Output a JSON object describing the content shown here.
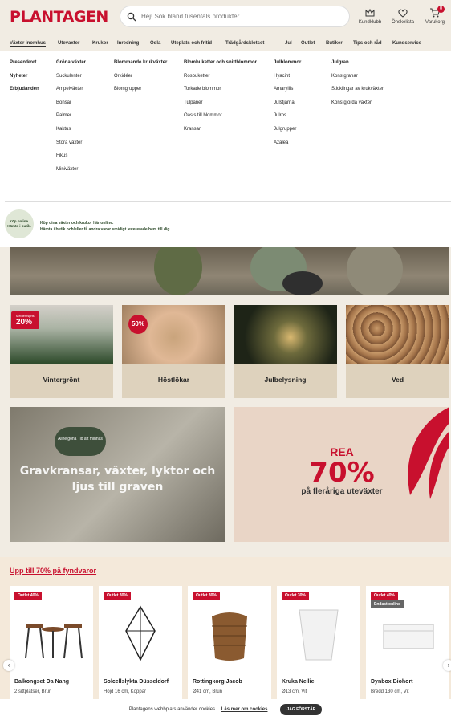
{
  "header": {
    "logo": "PLANTAGEN",
    "search_placeholder": "Hej! Sök bland tusentals produkter...",
    "icons": [
      {
        "name": "kundklubb",
        "label": "Kundklubb",
        "icon": "crown-icon"
      },
      {
        "name": "onskelista",
        "label": "Önskelista",
        "icon": "heart-icon"
      },
      {
        "name": "varukorg",
        "label": "Varukorg",
        "icon": "cart-icon",
        "badge": "0"
      }
    ]
  },
  "nav": [
    "Växter inomhus",
    "Utevaxter",
    "Krukor",
    "Inredning",
    "Odla",
    "Uteplats och fritid",
    "Trädgårdsklotset",
    "Jul",
    "Outlet",
    "Butiker",
    "Tips och råd",
    "Kundservice"
  ],
  "mega_menu": {
    "left_links": [
      "Presentkort",
      "Nyheter",
      "Erbjudanden"
    ],
    "col1": [
      "Gröna växter",
      "Suckulenter",
      "Ampelväxter",
      "Bonsai",
      "Palmer",
      "Kaktus",
      "Stora växter",
      "Fikus",
      "Miniväxter"
    ],
    "col2": [
      "Blommande krukväxter",
      "Orkidéer",
      "Blomgrupper"
    ],
    "col3": [
      "Blombuketter och snittblommor",
      "Rosbuketter",
      "Torkade blommor",
      "Tulpaner",
      "Oasis till blommor",
      "Kransar"
    ],
    "col4": [
      "Julblommor",
      "Hyacint",
      "Amaryllis",
      "Julstjärna",
      "Julros",
      "Julgrupper",
      "Azalea"
    ],
    "col5": [
      "Julgran",
      "Konstgranar",
      "Sticklingar av krukväxter",
      "Konstgjorda växter"
    ],
    "promo_circle": "Köp online. Hämta i butik.",
    "promo_line1": "Köp dina växter och krukor här online.",
    "promo_line2": "Hämta i butik och/eller få andra varor smidigt levererade hem till dig."
  },
  "tiles": [
    {
      "label": "Vintergrönt",
      "badge": "20%",
      "badge_small": "Medlemspris"
    },
    {
      "label": "Höstlökar",
      "badge": "50%"
    },
    {
      "label": "Julbelysning"
    },
    {
      "label": "Ved"
    }
  ],
  "banners": {
    "left_chip": "Allhelgona Tid att minnas",
    "left_title": "Gravkransar, växter, lyktor och ljus till graven",
    "right_a": "REA",
    "right_b": "70%",
    "right_c": "på fleråriga uteväxter"
  },
  "offers": {
    "title": "Upp till 70% på fyndvaror",
    "products": [
      {
        "label": "Outlet 40%",
        "name": "Balkongset Da Nang",
        "sub": "2 sittplatser, Brun"
      },
      {
        "label": "Outlet 30%",
        "name": "Solcellslykta Düsseldorf",
        "sub": "Höjd 16 cm, Koppar"
      },
      {
        "label": "Outlet 30%",
        "name": "Rottingkorg Jacob",
        "sub": "Ø41 cm, Brun"
      },
      {
        "label": "Outlet 30%",
        "name": "Kruka Nellie",
        "sub": "Ø13 cm, Vit"
      },
      {
        "label": "Outlet 40%",
        "label2": "Endast online",
        "name": "Dynbox Biohort",
        "sub": "Bredd 130 cm, Vit"
      }
    ]
  },
  "cookie": {
    "text": "Plantagens webbplats använder cookies.",
    "link": "Läs mer om cookies",
    "button": "JAG FÖRSTÅR"
  },
  "colors": {
    "brand_red": "#c8102e",
    "background": "#f1ece3",
    "green": "#2d4a2a"
  }
}
